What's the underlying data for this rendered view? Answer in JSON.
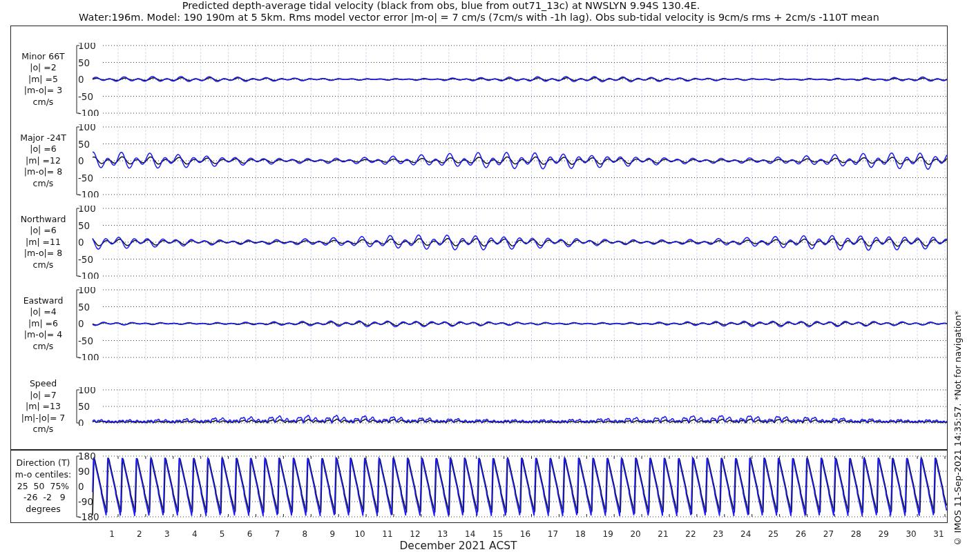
{
  "title": "Predicted depth-average tidal velocity (black from obs, blue from out71_13c) at NWSLYN 9.94S 130.4E.",
  "subtitle": "Water:196m. Model: 190 190m at 5 5km. Rms model vector error |m-o| = 7 cm/s (7cm/s with -1h lag). Obs sub-tidal velocity is 9cm/s rms + 2cm/s -110T mean",
  "panels": [
    {
      "kind": "velocity",
      "label": "Minor 66T\n|o| =2\n|m| =5\n|m-o|= 3\ncm/s",
      "yticks": [
        "100",
        "50",
        "0",
        "-50",
        "-100"
      ]
    },
    {
      "kind": "velocity",
      "label": "Major -24T\n|o| =6\n|m| =12\n|m-o|= 8\ncm/s",
      "yticks": [
        "100",
        "50",
        "0",
        "-50",
        "-100"
      ]
    },
    {
      "kind": "velocity",
      "label": "Northward\n|o| =6\n|m| =11\n|m-o|= 8\ncm/s",
      "yticks": [
        "100",
        "50",
        "0",
        "-50",
        "-100"
      ]
    },
    {
      "kind": "velocity",
      "label": "Eastward\n|o| =4\n|m| =6\n|m-o|= 4\ncm/s",
      "yticks": [
        "100",
        "50",
        "0",
        "-50",
        "-100"
      ]
    },
    {
      "kind": "speed",
      "label": "Speed\n|o| =7\n|m| =13\n|m|-|o|= 7\ncm/s",
      "yticks": [
        "100",
        "50",
        "0"
      ]
    }
  ],
  "direction_panel": {
    "label": "Direction (T)\nm-o centiles:\n25  50  75%\n -26  -2   9\ndegrees",
    "yticks": [
      "180",
      "90",
      "0",
      "-90",
      "-180"
    ]
  },
  "days": [
    "1",
    "2",
    "3",
    "4",
    "5",
    "6",
    "7",
    "8",
    "9",
    "10",
    "11",
    "12",
    "13",
    "14",
    "15",
    "16",
    "17",
    "18",
    "19",
    "20",
    "21",
    "22",
    "23",
    "24",
    "25",
    "26",
    "27",
    "28",
    "29",
    "30",
    "31"
  ],
  "xlabel": "December 2021 ACST",
  "credit": "© IMOS 11-Sep-2021 14:35:57. *Not for navigation*"
}
